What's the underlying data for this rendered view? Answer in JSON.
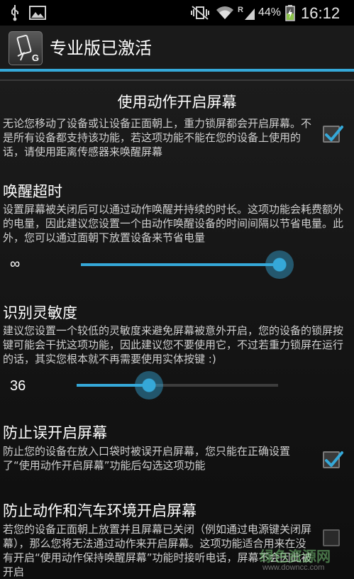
{
  "status_bar": {
    "battery_percent": "44%",
    "time": "16:12",
    "icons": [
      "usb-icon",
      "image-icon",
      "vibrate-mute-icon",
      "wifi-icon",
      "signal-icon",
      "battery-charging-icon"
    ]
  },
  "action_bar": {
    "app_icon_letter": "G",
    "title": "专业版已激活"
  },
  "settings": {
    "wake_on_motion": {
      "title": "使用动作开启屏幕",
      "summary": "无论您移动了设备或让设备正面朝上，重力锁屏都会开启屏幕。不是所有设备都支持该功能，若这项功能不能在您的设备上使用的话，请使用距离传感器来唤醒屏幕",
      "checked": true
    },
    "wake_timeout": {
      "title": "唤醒超时",
      "summary": "设置屏幕被关闭后可以通过动作唤醒并持续的时长。这项功能会耗费额外的电量，因此建议您设置一个由动作唤醒设备的时间间隔以节省电量。此外，您可以通过面朝下放置设备来节省电量",
      "value_label": "∞",
      "value_fraction": 1.0
    },
    "sensitivity": {
      "title": "识别灵敏度",
      "summary": "建议您设置一个较低的灵敏度来避免屏幕被意外开启，您的设备的锁屏按键可能会干扰这项功能，因此建议您不要使用它，不过若重力锁屏在运行的话，其实您根本就不再需要使用实体按键 :)",
      "value_label": "36",
      "value_fraction": 0.36
    },
    "pocket_protection": {
      "title": "防止误开启屏幕",
      "summary": "防止您的设备在放入口袋时被误开启屏幕，您只能在正确设置了“使用动作开启屏幕”功能后勾选这项功能",
      "checked": true
    },
    "motion_car_protection": {
      "title": "防止动作和汽车环境开启屏幕",
      "summary": "若您的设备正面朝上放置并且屏幕已关闭（例如通过电源键关闭屏幕），那么您将无法通过动作来开启屏幕。这项功能适合用来在没有开启“使用动作保持唤醒屏幕”功能时接听电话，屏幕不会因此被开启",
      "checked": false
    }
  },
  "watermark": {
    "main": "绿色资源网",
    "url": "www.downcc.com"
  },
  "colors": {
    "accent": "#35a8d8",
    "background": "#161616",
    "text_primary": "#ffffff",
    "text_secondary": "#d0d0d0"
  }
}
